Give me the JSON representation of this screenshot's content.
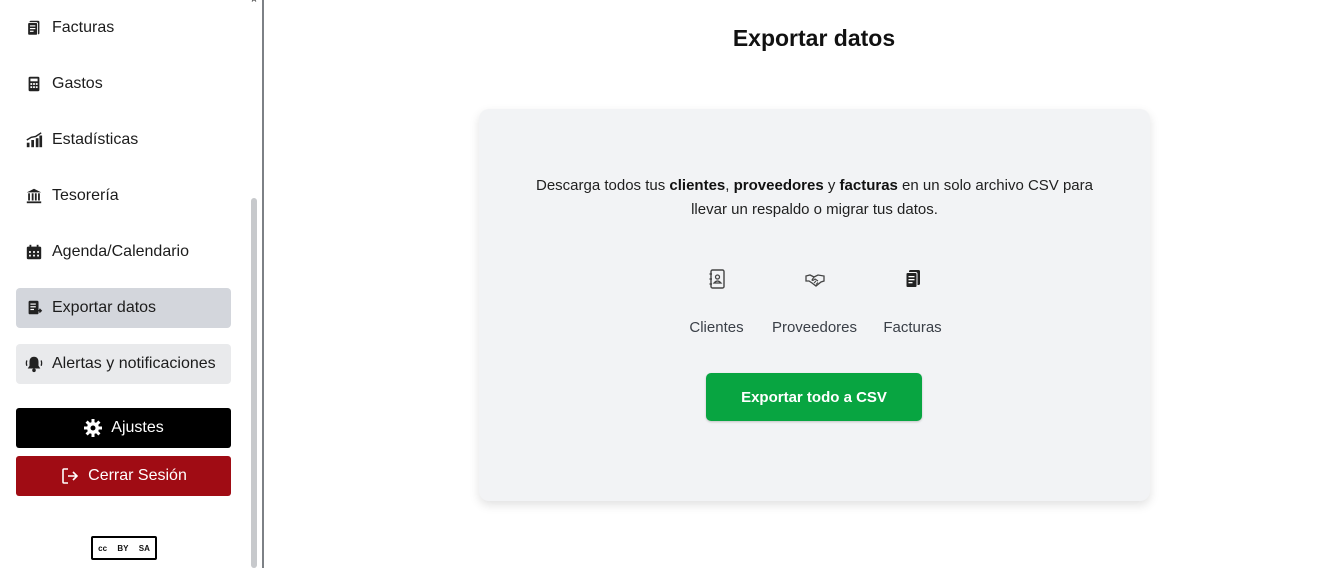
{
  "sidebar": {
    "items": [
      {
        "label": "Facturas",
        "icon": "invoice-icon"
      },
      {
        "label": "Gastos",
        "icon": "calculator-icon"
      },
      {
        "label": "Estadísticas",
        "icon": "chart-icon"
      },
      {
        "label": "Tesorería",
        "icon": "bank-icon"
      },
      {
        "label": "Agenda/Calendario",
        "icon": "calendar-icon"
      },
      {
        "label": "Exportar datos",
        "icon": "export-icon",
        "active": true
      },
      {
        "label": "Alertas y notificaciones",
        "icon": "bell-icon"
      }
    ],
    "settings_label": "Ajustes",
    "logout_label": "Cerrar Sesión",
    "license": {
      "cc": "cc",
      "by": "BY",
      "sa": "SA"
    }
  },
  "main": {
    "title": "Exportar datos",
    "card": {
      "desc_1": "Descarga todos tus ",
      "desc_bold_1": "clientes",
      "desc_2": ", ",
      "desc_bold_2": "proveedores",
      "desc_3": " y ",
      "desc_bold_3": "facturas",
      "desc_4": " en un solo archivo CSV para llevar un respaldo o migrar tus datos.",
      "types": [
        {
          "label": "Clientes",
          "icon": "address-book-icon"
        },
        {
          "label": "Proveedores",
          "icon": "handshake-icon"
        },
        {
          "label": "Facturas",
          "icon": "invoice-icon"
        }
      ],
      "export_button": "Exportar todo a CSV"
    }
  },
  "colors": {
    "active_item": "#d3d6dc",
    "settings_bg": "#000000",
    "logout_bg": "#a00c14",
    "export_bg": "#08a541",
    "card_bg": "#f2f3f5"
  }
}
